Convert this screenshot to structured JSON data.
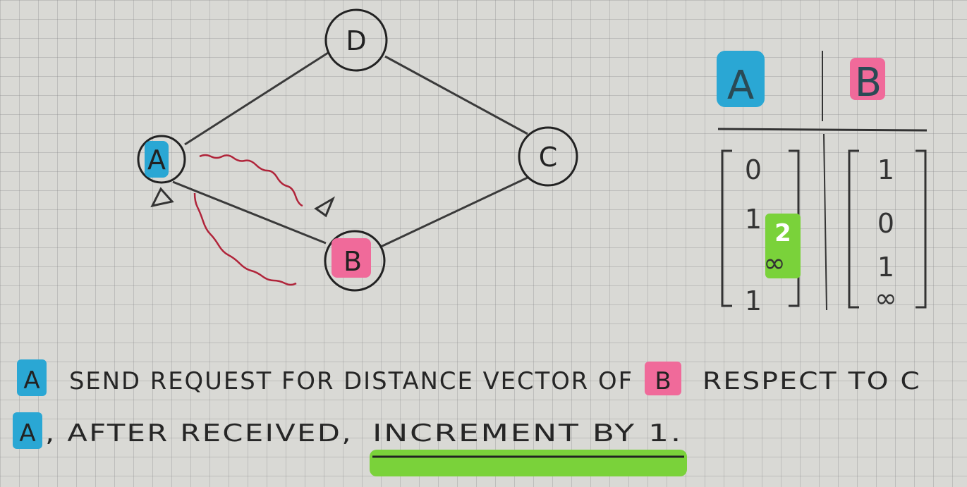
{
  "graph": {
    "nodes": {
      "a": {
        "label": "A",
        "highlight": "#2aa7d4"
      },
      "b": {
        "label": "B",
        "highlight": "#f06a9a"
      },
      "c": {
        "label": "C"
      },
      "d": {
        "label": "D"
      }
    },
    "edges": [
      "A-D",
      "D-C",
      "A-B",
      "B-C"
    ],
    "message_color": "#b0243a"
  },
  "tables": {
    "header_a": "A",
    "header_b": "B",
    "vector_a": {
      "row1": "0",
      "row2": "1",
      "row2_update": "2",
      "row3": "∞",
      "row4": "1"
    },
    "vector_b": {
      "row1": "1",
      "row2": "0",
      "row3": "1",
      "row4": "∞"
    },
    "update_color": "#7ad23a"
  },
  "notes": {
    "line1": {
      "node_a": "A",
      "text_1": "SEND REQUEST FOR DISTANCE VECTOR OF",
      "node_b": "B",
      "text_2": "RESPECT TO C"
    },
    "line2": {
      "node_a": "A",
      "text_1": ", AFTER RECEIVED,",
      "text_2": "INCREMENT BY 1."
    },
    "underline_color": "#7ad23a"
  }
}
